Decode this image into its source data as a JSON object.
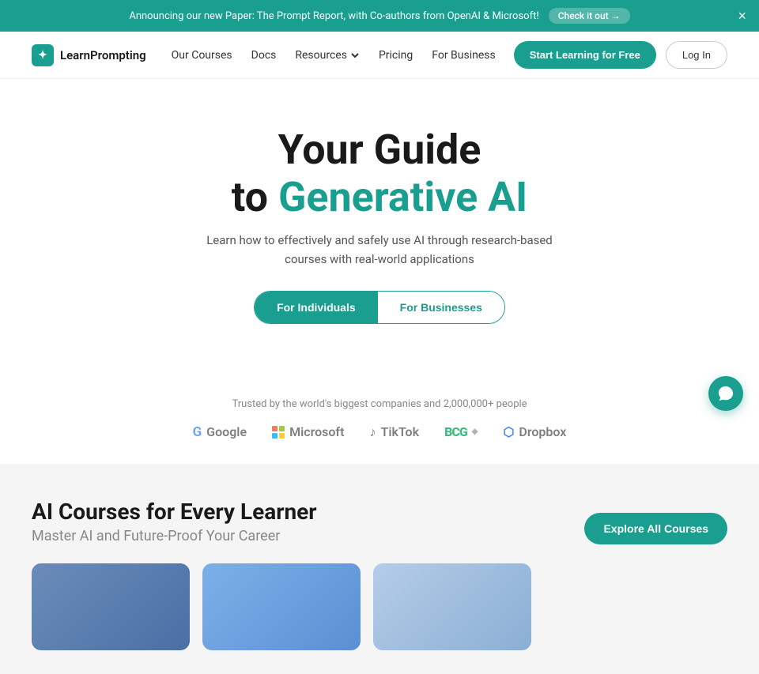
{
  "announcement": {
    "text": "Announcing our new Paper: The Prompt Report, with Co-authors from OpenAI & Microsoft!",
    "cta_label": "Check it out →",
    "close_label": "×"
  },
  "nav": {
    "logo_text": "LearnPrompting",
    "logo_icon": "✦",
    "links": [
      {
        "label": "Our Courses",
        "has_dropdown": false
      },
      {
        "label": "Docs",
        "has_dropdown": false
      },
      {
        "label": "Resources",
        "has_dropdown": true
      },
      {
        "label": "Pricing",
        "has_dropdown": false
      },
      {
        "label": "For Business",
        "has_dropdown": false
      }
    ],
    "cta_primary": "Start Learning for Free",
    "cta_secondary": "Log In"
  },
  "hero": {
    "line1": "Your Guide",
    "line2_plain": "to ",
    "line2_accent": "Generative AI",
    "subtitle": "Learn how to effectively and safely use AI through research-based courses with real-world applications",
    "btn_individuals": "For Individuals",
    "btn_businesses": "For Businesses"
  },
  "trusted": {
    "label": "Trusted by the world's biggest companies and 2,000,000+ people",
    "companies": [
      {
        "name": "Google",
        "icon": "google"
      },
      {
        "name": "Microsoft",
        "icon": "microsoft"
      },
      {
        "name": "TikTok",
        "icon": "tiktok"
      },
      {
        "name": "BCG",
        "icon": "bcg"
      },
      {
        "name": "Dropbox",
        "icon": "dropbox"
      }
    ]
  },
  "courses_section": {
    "heading": "AI Courses for Every Learner",
    "subheading": "Master AI and Future-Proof Your Career",
    "explore_btn": "Explore All Courses"
  },
  "chat": {
    "icon_label": "chat-icon"
  }
}
